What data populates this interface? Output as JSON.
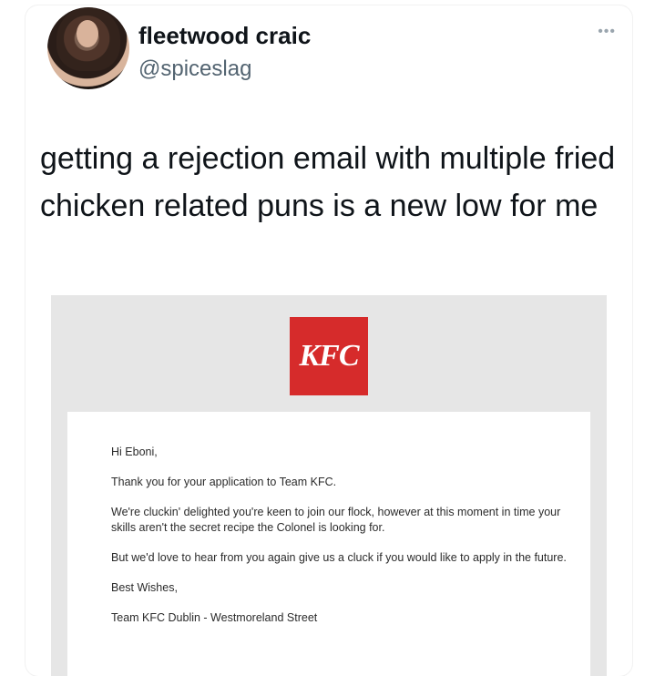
{
  "tweet": {
    "display_name": "fleetwood craic",
    "handle": "@spiceslag",
    "more_icon": "more-horizontal-icon",
    "text": "getting a rejection email with multiple fried chicken related puns is a new low for me"
  },
  "email": {
    "logo_text": "KFC",
    "logo_color": "#d62b2b",
    "greeting": "Hi Eboni,",
    "line1": "Thank you for your application to Team KFC.",
    "line2": "We're cluckin' delighted you're keen to join our flock, however at this moment in time your skills aren't the secret recipe the Colonel is looking for.",
    "line3": "But we'd love to hear from you again give us a cluck if you would like to apply in the future.",
    "signoff": "Best Wishes,",
    "signature": "Team KFC Dublin - Westmoreland Street"
  }
}
